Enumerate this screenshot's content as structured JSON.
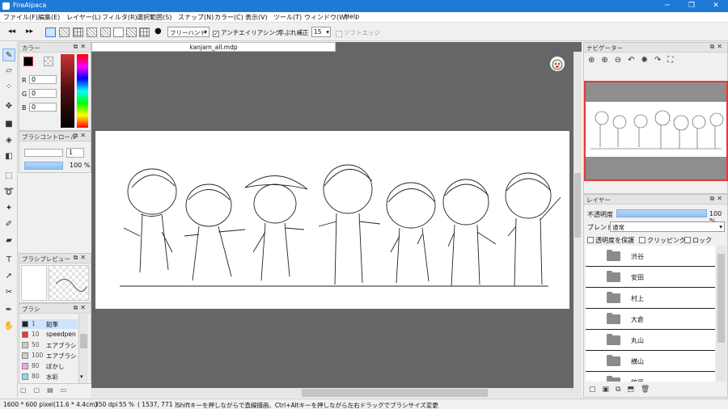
{
  "window": {
    "title": "FireAlpaca",
    "minimize": "─",
    "maximize": "❐",
    "close": "✕"
  },
  "menu": [
    "ファイル(F)",
    "編集(E)",
    "レイヤー(L)",
    "フィルタ(R)",
    "選択範囲(S)",
    "スナップ(N)",
    "カラー(C)",
    "表示(V)",
    "ツール(T)",
    "ウィンドウ(W)",
    "Help"
  ],
  "toolbar": {
    "brush_mode": "フリーハンド",
    "antialias_label": "アンチエイリアシング",
    "antialias_checked": true,
    "stabilizer_label": "手ぶれ補正",
    "stabilizer_value": "15",
    "soft_edge_label": "ソフトエッジ"
  },
  "color_panel": {
    "title": "カラー",
    "r_label": "R",
    "g_label": "G",
    "b_label": "B",
    "r": "0",
    "g": "0",
    "b": "0"
  },
  "brush_control": {
    "title": "ブラシコントロール",
    "size": "1",
    "opacity": "100 %"
  },
  "brush_preview": {
    "title": "ブラシプレビュー"
  },
  "brush_panel": {
    "title": "ブラシ",
    "items": [
      {
        "size": "1",
        "name": "鉛筆",
        "color": "#222222",
        "selected": true
      },
      {
        "size": "10",
        "name": "speedpen",
        "color": "#e53935"
      },
      {
        "size": "50",
        "name": "エアブラシ",
        "color": "#cccccc"
      },
      {
        "size": "100",
        "name": "エアブラシ",
        "color": "#cccccc"
      },
      {
        "size": "80",
        "name": "ぼかし",
        "color": "#f4a6e6"
      },
      {
        "size": "80",
        "name": "水彩",
        "color": "#8fd6f0"
      }
    ]
  },
  "document": {
    "tab": "kanjam_all.mdp"
  },
  "navigator": {
    "title": "ナビゲーター"
  },
  "layer_panel": {
    "title": "レイヤー",
    "opacity_label": "不透明度",
    "opacity_value": "100 %",
    "blend_label": "ブレンド",
    "blend_value": "通常",
    "protect_label": "透明度を保護",
    "clipping_label": "クリッピング",
    "lock_label": "ロック",
    "layers": [
      "渋谷",
      "安田",
      "村上",
      "大倉",
      "丸山",
      "横山",
      "錦戸"
    ]
  },
  "status": {
    "size": "1600 * 600 pixel",
    "physical": "(11.6 * 4.4cm)",
    "dpi": "350 dpi",
    "zoom": "55 %",
    "coords": "( 1537, 771 )",
    "hint": "Shiftキーを押しながらで直線描画、Ctrl+Altキーを押しながら左右ドラッグでブラシサイズ変更"
  }
}
